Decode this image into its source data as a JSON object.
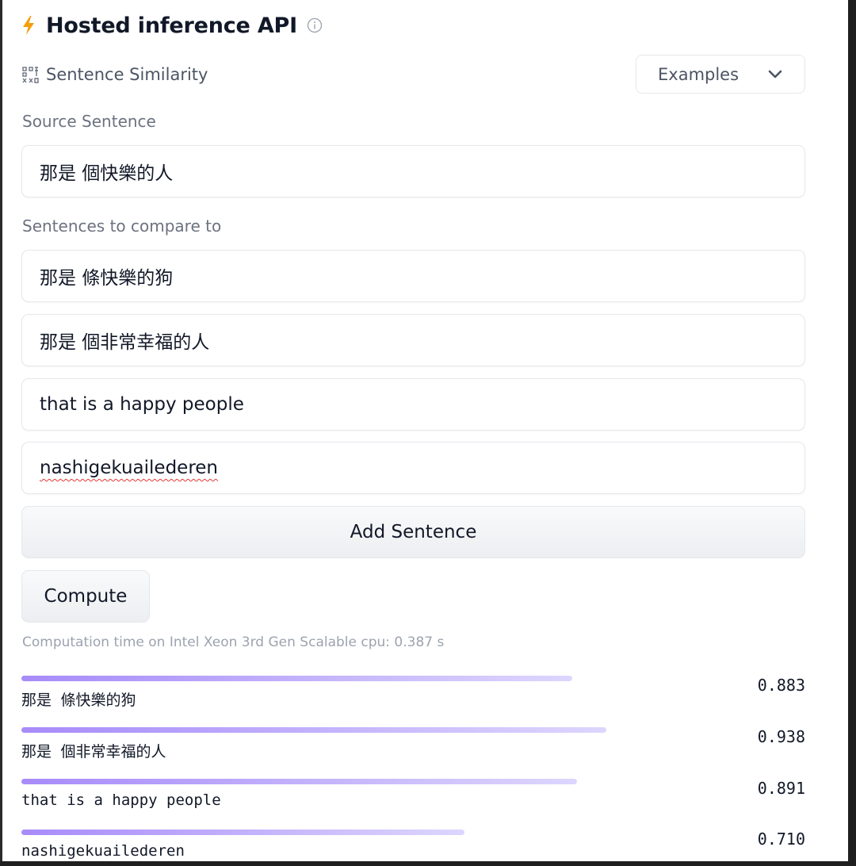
{
  "header": {
    "title": "Hosted inference API"
  },
  "task": {
    "label": "Sentence Similarity"
  },
  "examples": {
    "label": "Examples"
  },
  "source": {
    "label": "Source Sentence",
    "value": "那是 個快樂的人"
  },
  "compare": {
    "label": "Sentences to compare to",
    "sentences": [
      "那是 條快樂的狗",
      "那是 個非常幸福的人",
      "that is a happy people",
      "nashigekuailederen"
    ]
  },
  "buttons": {
    "add": "Add Sentence",
    "compute": "Compute"
  },
  "timing": "Computation time on Intel Xeon 3rd Gen Scalable cpu: 0.387 s",
  "results": [
    {
      "label": "那是 條快樂的狗",
      "score": "0.883",
      "value": 0.883
    },
    {
      "label": "那是 個非常幸福的人",
      "score": "0.938",
      "value": 0.938
    },
    {
      "label": "that is a happy people",
      "score": "0.891",
      "value": 0.891
    },
    {
      "label": "nashigekuailederen",
      "score": "0.710",
      "value": 0.71
    }
  ],
  "colors": {
    "accent": "#a78bfa",
    "bolt": "#f59e0b"
  }
}
